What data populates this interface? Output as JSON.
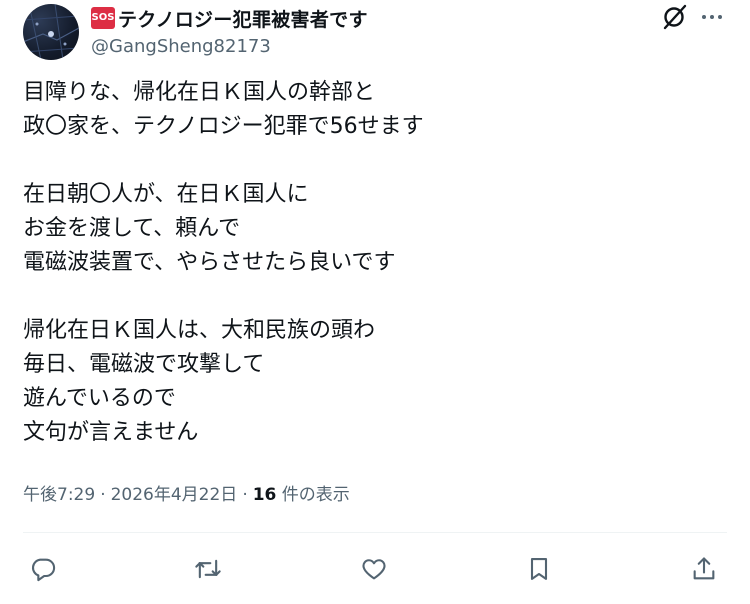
{
  "author": {
    "badge_text": "SOS",
    "display_name": "テクノロジー犯罪被害者です",
    "handle": "@GangSheng82173"
  },
  "tweet": {
    "lines": [
      "目障りな、帰化在日Ｋ国人の幹部と",
      "政〇家を、テクノロジー犯罪で56せます",
      "",
      "在日朝〇人が、在日Ｋ国人に",
      "お金を渡して、頼んで",
      "電磁波装置で、やらさせたら良いです",
      "",
      "帰化在日Ｋ国人は、大和民族の頭わ",
      "毎日、電磁波で攻撃して",
      "遊んでいるので",
      "文句が言えません"
    ]
  },
  "meta": {
    "time": "午後7:29",
    "separator": "·",
    "date": "2026年4月22日",
    "views_count": "16",
    "views_label": "件の表示"
  },
  "icons": {
    "grok": "grok-icon",
    "more": "more-icon",
    "reply": "reply-icon",
    "retweet": "retweet-icon",
    "like": "like-icon",
    "bookmark": "bookmark-icon",
    "share": "share-icon"
  },
  "colors": {
    "text": "#0f1419",
    "secondary": "#536471",
    "badge": "#dd2e44",
    "divider": "#eff3f4"
  }
}
